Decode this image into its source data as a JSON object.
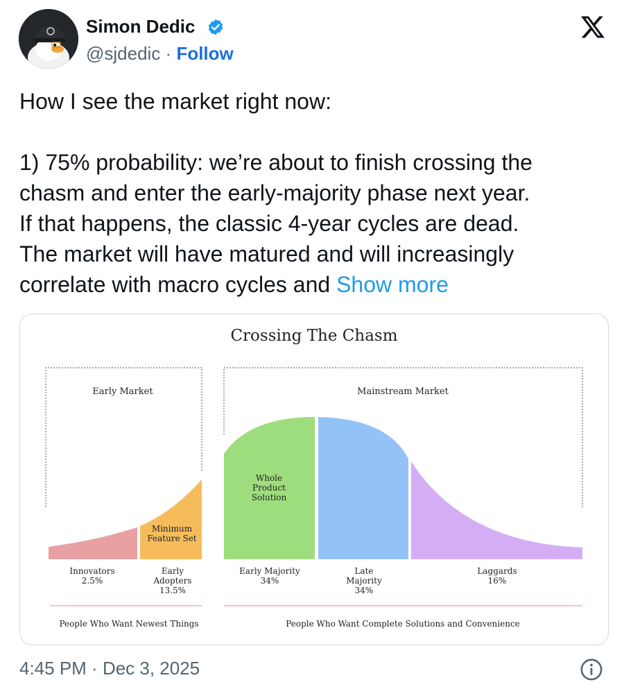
{
  "author": {
    "name": "Simon Dedic",
    "handle": "@sjdedic",
    "separator": " · ",
    "follow_label": "Follow"
  },
  "icons": {
    "avatar": "avatar-image",
    "verified": "verified-badge-icon",
    "platform": "x-logo-icon",
    "info": "info-icon"
  },
  "colors": {
    "link": "#1d9bf0",
    "follow": "#1d6fd9",
    "verified": "#1d9bf0",
    "innovators": "#e8a0a3",
    "early_adopters": "#f6bc5c",
    "early_majority": "#9edd7d",
    "late_majority": "#93c2f7",
    "laggards": "#d3aef5",
    "divider": "#e8a0a3"
  },
  "tweet": {
    "lines": [
      "How I see the market right now:",
      "1) 75% probability: we’re about to finish crossing the",
      "chasm and enter the early-majority phase next year.",
      "If that happens, the classic 4-year cycles are dead.",
      "The market will have matured and will increasingly",
      "correlate with macro cycles and "
    ],
    "show_more": "Show more"
  },
  "media": {
    "title": "Crossing The Chasm",
    "early_market_label": "Early Market",
    "mainstream_market_label": "Mainstream Market",
    "inside_labels": {
      "minimum_feature_set": [
        "Minimum",
        "Feature Set"
      ],
      "whole_product_solution": [
        "Whole",
        "Product",
        "Solution"
      ]
    },
    "segments": [
      {
        "name_lines": [
          "Innovators"
        ],
        "share": "2.5%"
      },
      {
        "name_lines": [
          "Early",
          "Adopters"
        ],
        "share": "13.5%"
      },
      {
        "name_lines": [
          "Early Majority"
        ],
        "share": "34%"
      },
      {
        "name_lines": [
          "Late",
          "Majority"
        ],
        "share": "34%"
      },
      {
        "name_lines": [
          "Laggards"
        ],
        "share": "16%"
      }
    ],
    "footer_left": "People Who Want Newest Things",
    "footer_right": "People Who Want Complete Solutions and Convenience"
  },
  "footer": {
    "time": "4:45 PM",
    "separator": " · ",
    "date": "Dec 3, 2025"
  }
}
